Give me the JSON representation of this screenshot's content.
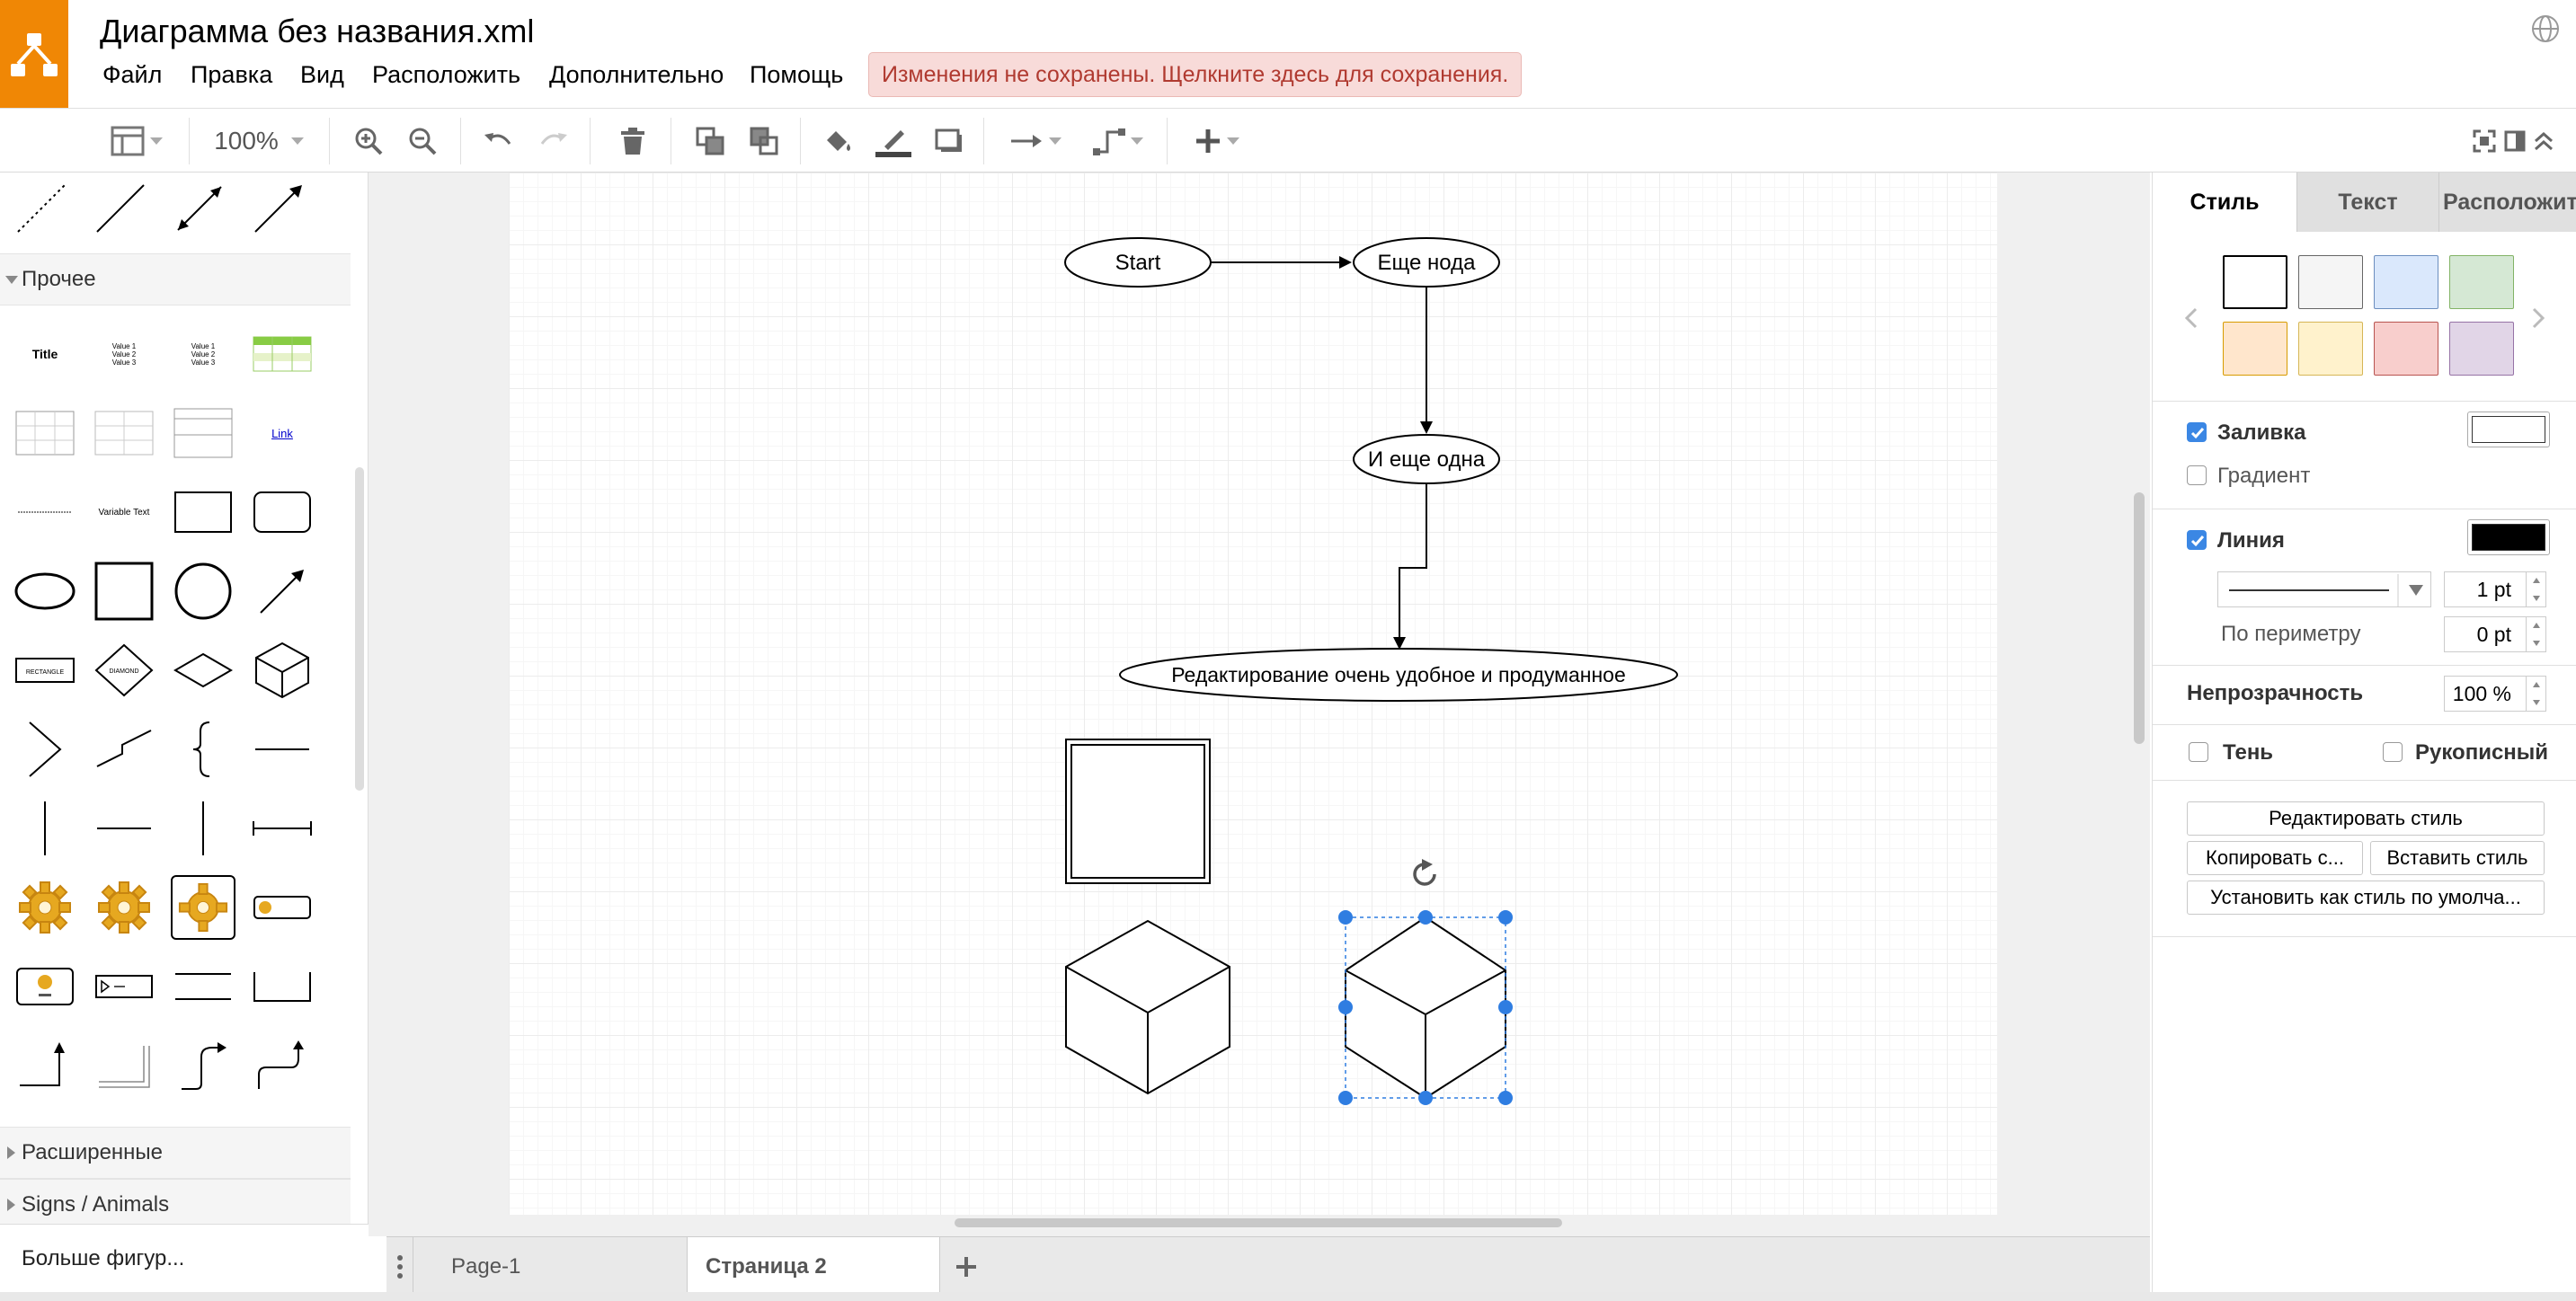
{
  "app": {
    "title": "Диаграмма без названия.xml",
    "brand_color": "#f08705"
  },
  "menu": {
    "items": [
      "Файл",
      "Правка",
      "Вид",
      "Расположить",
      "Дополнительно",
      "Помощь"
    ]
  },
  "notice": {
    "unsaved": "Изменения не сохранены. Щелкните здесь для сохранения."
  },
  "toolbar": {
    "zoom": "100%",
    "icons": [
      "format-panel-icon",
      "zoom-in-icon",
      "zoom-out-icon",
      "undo-icon",
      "redo-icon",
      "delete-icon",
      "to-front-icon",
      "to-back-icon",
      "fill-color-icon",
      "line-color-icon",
      "shadow-icon",
      "connection-icon",
      "waypoints-icon",
      "insert-icon",
      "fullscreen-icon",
      "format-toggle-icon",
      "collapse-icon"
    ]
  },
  "sidebar": {
    "sections": {
      "misc": "Прочее",
      "advanced": "Расширенные",
      "signs": "Signs / Animals"
    },
    "shape_labels": {
      "title": "Title",
      "link": "Link",
      "variable_text": "Variable Text",
      "value1": "Value 1",
      "value2": "Value 2",
      "value3": "Value 3",
      "rectangle": "RECTANGLE",
      "diamond": "DIAMOND"
    },
    "more_shapes": "Больше фигур..."
  },
  "diagram": {
    "nodes": {
      "start": "Start",
      "node2": "Еще нода",
      "node3": "И еще одна",
      "node4": "Редактирование очень удобное и продуманное"
    },
    "selection_color": "#2f7de1"
  },
  "pages": {
    "tabs": [
      "Page-1",
      "Страница 2"
    ],
    "active": "Страница 2"
  },
  "format_panel": {
    "tabs": [
      "Стиль",
      "Текст",
      "Расположит"
    ],
    "active_tab": "Стиль",
    "swatches": [
      {
        "fill": "#ffffff",
        "stroke": "#000000"
      },
      {
        "fill": "#f5f5f5",
        "stroke": "#666666"
      },
      {
        "fill": "#dae8fc",
        "stroke": "#6c8ebf"
      },
      {
        "fill": "#d5e8d4",
        "stroke": "#82b366"
      },
      {
        "fill": "#ffe6cc",
        "stroke": "#d79b00"
      },
      {
        "fill": "#fff2cc",
        "stroke": "#d6b656"
      },
      {
        "fill": "#f8cecc",
        "stroke": "#b85450"
      },
      {
        "fill": "#e1d5e7",
        "stroke": "#9673a6"
      }
    ],
    "fill": {
      "label": "Заливка",
      "checked": true,
      "color": "#ffffff"
    },
    "gradient": {
      "label": "Градиент",
      "checked": false
    },
    "line": {
      "label": "Линия",
      "checked": true,
      "color": "#000000",
      "width": "1 pt"
    },
    "perimeter": {
      "label": "По периметру",
      "value": "0 pt"
    },
    "opacity": {
      "label": "Непрозрачность",
      "value": "100 %"
    },
    "shadow": {
      "label": "Тень",
      "checked": false
    },
    "sketch": {
      "label": "Рукописный",
      "checked": false
    },
    "buttons": {
      "edit_style": "Редактировать стиль",
      "copy_style": "Копировать с...",
      "paste_style": "Вставить стиль",
      "set_default": "Установить как стиль по умолча..."
    }
  }
}
